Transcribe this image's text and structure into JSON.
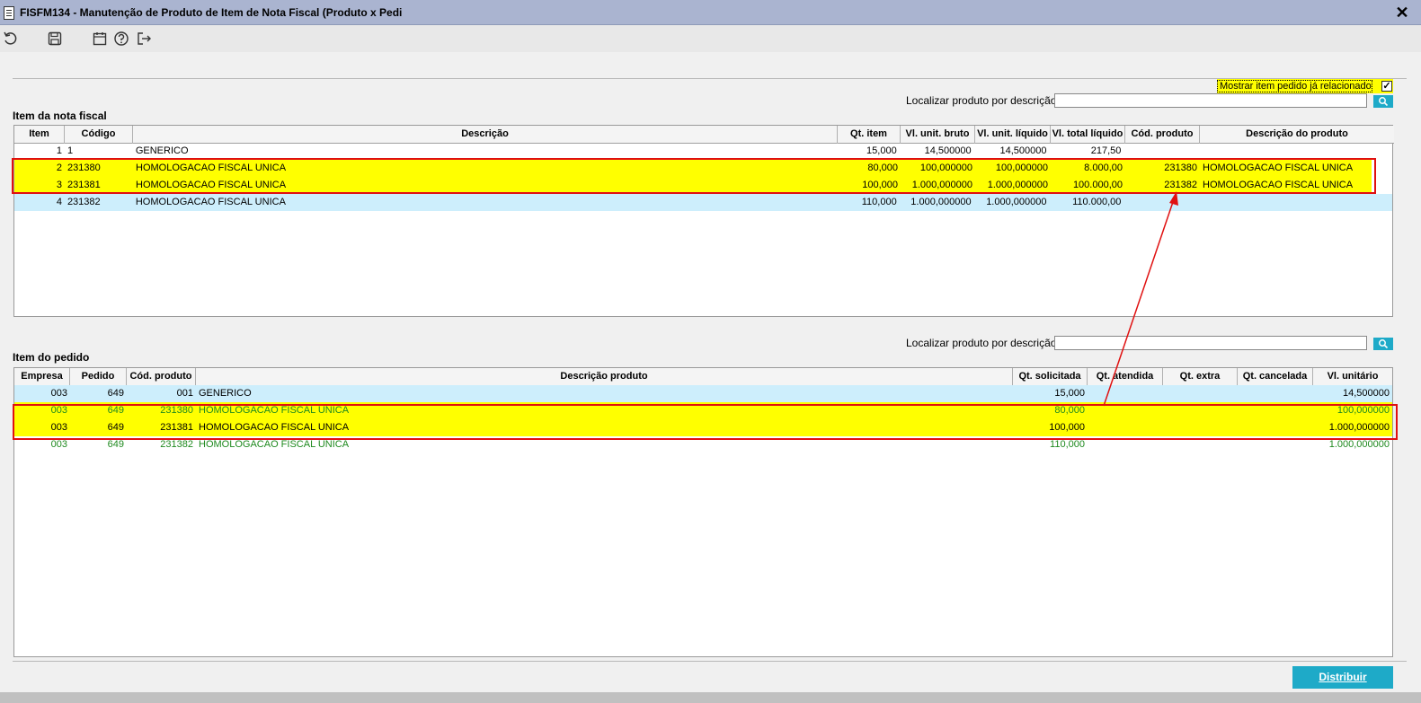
{
  "window": {
    "title": "FISFM134 - Manutenção de Produto de Item de Nota Fiscal (Produto x Pedi",
    "close_label": "✕"
  },
  "toolbar": {
    "icons": [
      "undo-icon",
      "save-icon",
      "calendar-icon",
      "help-icon",
      "exit-icon"
    ]
  },
  "filter": {
    "show_related_label": "Mostrar item pedido já relacionado",
    "show_related_checked": true,
    "check_mark": "✓"
  },
  "nota": {
    "search_label": "Localizar produto por descrição",
    "search_value": "",
    "section_label": "Item da nota fiscal",
    "columns": [
      "Item",
      "Código",
      "Descrição",
      "Qt. item",
      "Vl. unit. bruto",
      "Vl. unit. líquido",
      "Vl. total líquido",
      "Cód. produto",
      "Descrição do produto"
    ],
    "rows": [
      {
        "item": "1",
        "codigo": "1",
        "descricao": "GENERICO",
        "qt_item": "15,000",
        "vl_bruto": "14,500000",
        "vl_liquido": "14,500000",
        "vl_total": "217,50",
        "cod_produto": "",
        "desc_produto": ""
      },
      {
        "item": "2",
        "codigo": "231380",
        "descricao": "HOMOLOGACAO FISCAL UNICA",
        "qt_item": "80,000",
        "vl_bruto": "100,000000",
        "vl_liquido": "100,000000",
        "vl_total": "8.000,00",
        "cod_produto": "231380",
        "desc_produto": "HOMOLOGACAO FISCAL UNICA"
      },
      {
        "item": "3",
        "codigo": "231381",
        "descricao": "HOMOLOGACAO FISCAL UNICA",
        "qt_item": "100,000",
        "vl_bruto": "1.000,000000",
        "vl_liquido": "1.000,000000",
        "vl_total": "100.000,00",
        "cod_produto": "231382",
        "desc_produto": "HOMOLOGACAO FISCAL UNICA"
      },
      {
        "item": "4",
        "codigo": "231382",
        "descricao": "HOMOLOGACAO FISCAL UNICA",
        "qt_item": "110,000",
        "vl_bruto": "1.000,000000",
        "vl_liquido": "1.000,000000",
        "vl_total": "110.000,00",
        "cod_produto": "",
        "desc_produto": ""
      }
    ]
  },
  "pedido": {
    "search_label": "Localizar produto por descrição",
    "search_value": "",
    "section_label": "Item do pedido",
    "columns": [
      "Empresa",
      "Pedido",
      "Cód. produto",
      "Descrição produto",
      "Qt. solicitada",
      "Qt. atendida",
      "Qt. extra",
      "Qt. cancelada",
      "Vl. unitário"
    ],
    "rows": [
      {
        "empresa": "003",
        "pedido": "649",
        "cod_produto": "001",
        "descricao": "GENERICO",
        "qt_solicitada": "15,000",
        "qt_atendida": "",
        "qt_extra": "",
        "qt_cancelada": "",
        "vl_unitario": "14,500000"
      },
      {
        "empresa": "003",
        "pedido": "649",
        "cod_produto": "231380",
        "descricao": "HOMOLOGACAO FISCAL UNICA",
        "qt_solicitada": "80,000",
        "qt_atendida": "",
        "qt_extra": "",
        "qt_cancelada": "",
        "vl_unitario": "100,000000"
      },
      {
        "empresa": "003",
        "pedido": "649",
        "cod_produto": "231381",
        "descricao": "HOMOLOGACAO FISCAL UNICA",
        "qt_solicitada": "100,000",
        "qt_atendida": "",
        "qt_extra": "",
        "qt_cancelada": "",
        "vl_unitario": "1.000,000000"
      },
      {
        "empresa": "003",
        "pedido": "649",
        "cod_produto": "231382",
        "descricao": "HOMOLOGACAO FISCAL UNICA",
        "qt_solicitada": "110,000",
        "qt_atendida": "",
        "qt_extra": "",
        "qt_cancelada": "",
        "vl_unitario": "1.000,000000"
      }
    ]
  },
  "actions": {
    "distribuir_label": "Distribuir"
  },
  "colors": {
    "highlight": "#ffff00",
    "selected_row": "#cdeefc",
    "related_text": "#1f8a1f",
    "accent": "#1eaac8",
    "annotation": "#e01010"
  }
}
